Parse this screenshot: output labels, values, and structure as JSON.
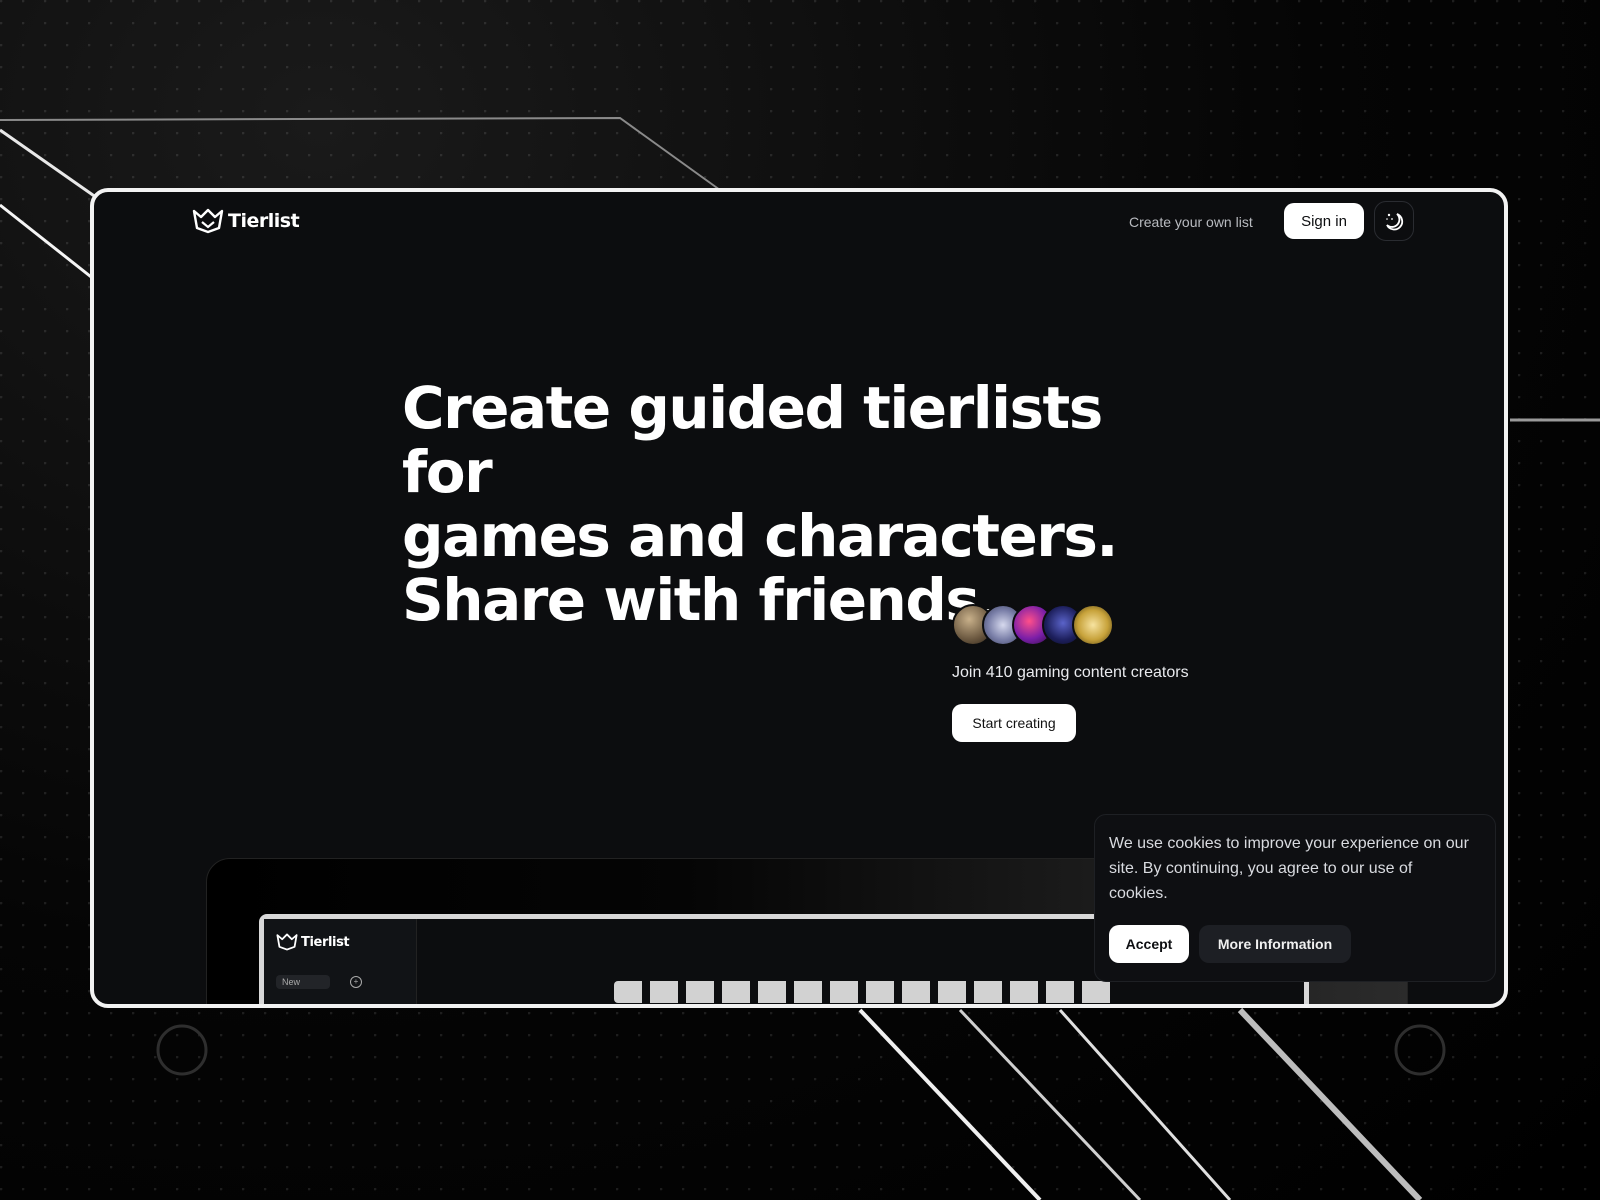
{
  "header": {
    "logo_text": "Tierlist",
    "nav_link": "Create your own list",
    "signin_label": "Sign in",
    "theme_toggle_icon": "moon-sparkle-icon"
  },
  "hero": {
    "title_lines": [
      "Create guided tierlists for",
      "games and characters.",
      "Share with friends."
    ],
    "join_text": "Join 410 gaming content creators",
    "cta_label": "Start creating"
  },
  "preview": {
    "logo_text": "Tierlist",
    "new_label": "New"
  },
  "cookie": {
    "message": "We use cookies to improve your experience on our site. By continuing, you agree to our use of cookies.",
    "accept_label": "Accept",
    "more_label": "More Information"
  },
  "colors": {
    "page_bg": "#0c0d0f",
    "frame_border": "#f2f2f2",
    "primary_button": "#ffffff",
    "secondary_button": "#1d1f24"
  }
}
